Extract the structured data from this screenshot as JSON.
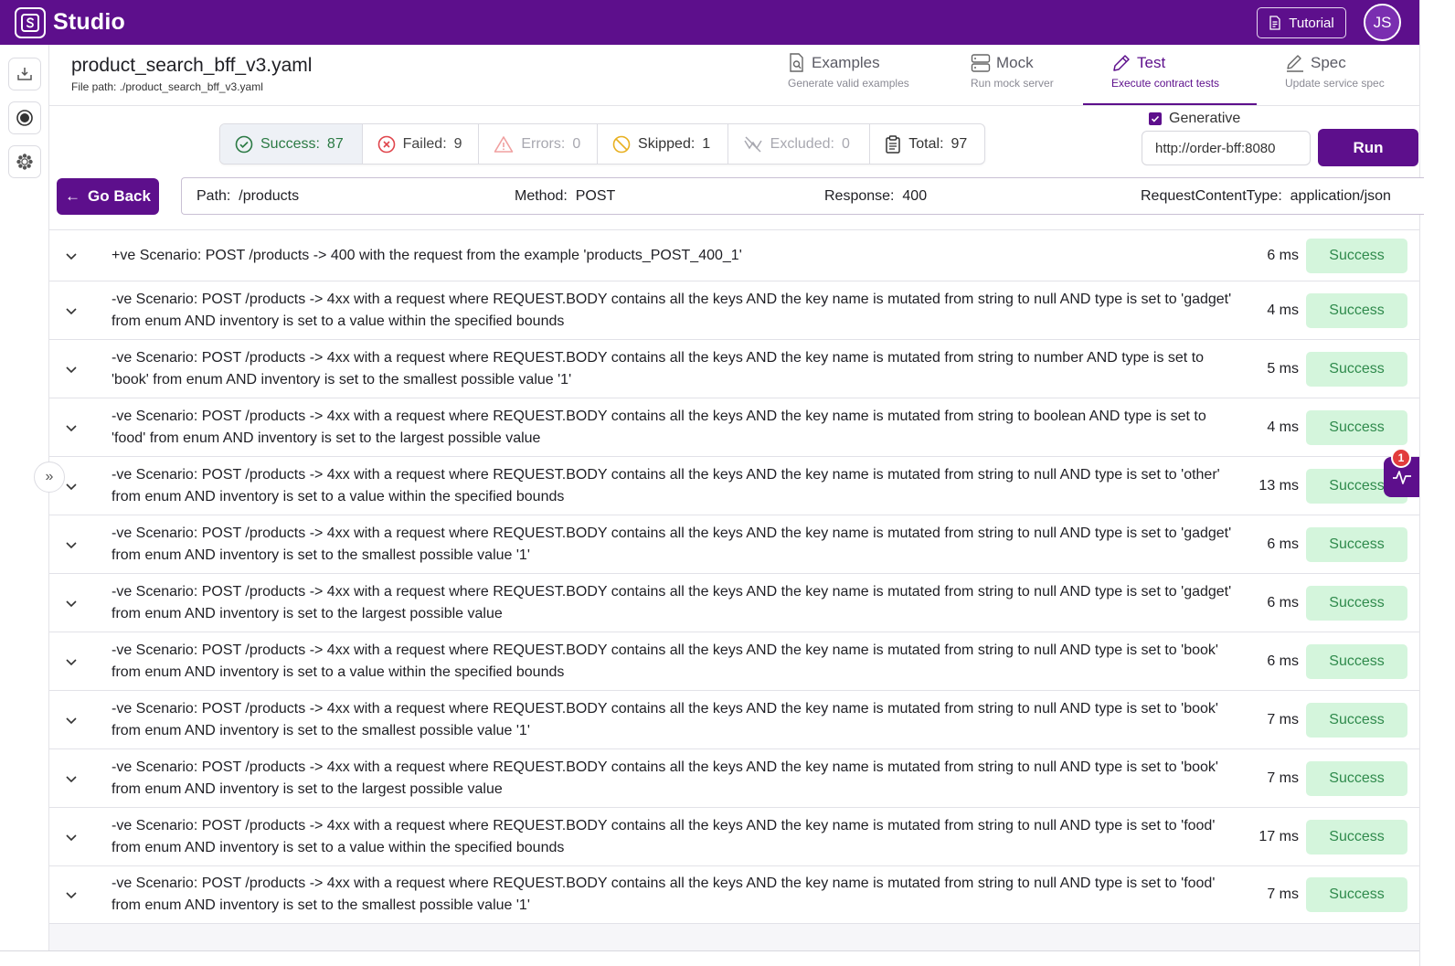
{
  "app": {
    "name": "Studio",
    "tutorial_label": "Tutorial",
    "avatar_initials": "JS"
  },
  "file": {
    "name": "product_search_bff_v3.yaml",
    "path": "File path: ./product_search_bff_v3.yaml"
  },
  "nav_tabs": [
    {
      "label": "Examples",
      "sub": "Generate valid examples",
      "icon": "file-search-icon",
      "active": false
    },
    {
      "label": "Mock",
      "sub": "Run mock server",
      "icon": "server-icon",
      "active": false
    },
    {
      "label": "Test",
      "sub": "Execute contract tests",
      "icon": "pencil-icon",
      "active": true
    },
    {
      "label": "Spec",
      "sub": "Update service spec",
      "icon": "edit-icon",
      "active": false
    }
  ],
  "summary": {
    "success": {
      "label": "Success:",
      "value": "87"
    },
    "failed": {
      "label": "Failed:",
      "value": "9"
    },
    "errors": {
      "label": "Errors:",
      "value": "0"
    },
    "skipped": {
      "label": "Skipped:",
      "value": "1"
    },
    "excluded": {
      "label": "Excluded:",
      "value": "0"
    },
    "total": {
      "label": "Total:",
      "value": "97"
    }
  },
  "controls": {
    "generative_label": "Generative",
    "generative_checked": true,
    "url_value": "http://order-bff:8080",
    "run_label": "Run",
    "go_back_label": "Go Back"
  },
  "info": {
    "path_label": "Path:",
    "path_value": "/products",
    "method_label": "Method:",
    "method_value": "POST",
    "response_label": "Response:",
    "response_value": "400",
    "content_type_label": "RequestContentType:",
    "content_type_value": "application/json"
  },
  "notification_count": "1",
  "colors": {
    "brand": "#5d0f8c",
    "success_bg": "#d4f5dc",
    "success_text": "#2f8a4c",
    "failed": "#e0454c",
    "skipped": "#e8b020"
  },
  "results": [
    {
      "text": "+ve Scenario: POST /products -> 400 with the request from the example 'products_POST_400_1'",
      "duration": "6 ms",
      "status": "Success"
    },
    {
      "text": "-ve Scenario: POST /products -> 4xx with a request where REQUEST.BODY contains all the keys AND the key name is mutated from string to null AND type is set to 'gadget' from enum AND inventory is set to a value within the specified bounds",
      "duration": "4 ms",
      "status": "Success"
    },
    {
      "text": "-ve Scenario: POST /products -> 4xx with a request where REQUEST.BODY contains all the keys AND the key name is mutated from string to number AND type is set to 'book' from enum AND inventory is set to the smallest possible value '1'",
      "duration": "5 ms",
      "status": "Success"
    },
    {
      "text": "-ve Scenario: POST /products -> 4xx with a request where REQUEST.BODY contains all the keys AND the key name is mutated from string to boolean AND type is set to 'food' from enum AND inventory is set to the largest possible value",
      "duration": "4 ms",
      "status": "Success"
    },
    {
      "text": "-ve Scenario: POST /products -> 4xx with a request where REQUEST.BODY contains all the keys AND the key name is mutated from string to null AND type is set to 'other' from enum AND inventory is set to a value within the specified bounds",
      "duration": "13 ms",
      "status": "Success"
    },
    {
      "text": "-ve Scenario: POST /products -> 4xx with a request where REQUEST.BODY contains all the keys AND the key name is mutated from string to null AND type is set to 'gadget' from enum AND inventory is set to the smallest possible value '1'",
      "duration": "6 ms",
      "status": "Success"
    },
    {
      "text": "-ve Scenario: POST /products -> 4xx with a request where REQUEST.BODY contains all the keys AND the key name is mutated from string to null AND type is set to 'gadget' from enum AND inventory is set to the largest possible value",
      "duration": "6 ms",
      "status": "Success"
    },
    {
      "text": "-ve Scenario: POST /products -> 4xx with a request where REQUEST.BODY contains all the keys AND the key name is mutated from string to null AND type is set to 'book' from enum AND inventory is set to a value within the specified bounds",
      "duration": "6 ms",
      "status": "Success"
    },
    {
      "text": "-ve Scenario: POST /products -> 4xx with a request where REQUEST.BODY contains all the keys AND the key name is mutated from string to null AND type is set to 'book' from enum AND inventory is set to the smallest possible value '1'",
      "duration": "7 ms",
      "status": "Success"
    },
    {
      "text": "-ve Scenario: POST /products -> 4xx with a request where REQUEST.BODY contains all the keys AND the key name is mutated from string to null AND type is set to 'book' from enum AND inventory is set to the largest possible value",
      "duration": "7 ms",
      "status": "Success"
    },
    {
      "text": "-ve Scenario: POST /products -> 4xx with a request where REQUEST.BODY contains all the keys AND the key name is mutated from string to null AND type is set to 'food' from enum AND inventory is set to a value within the specified bounds",
      "duration": "17 ms",
      "status": "Success"
    },
    {
      "text": "-ve Scenario: POST /products -> 4xx with a request where REQUEST.BODY contains all the keys AND the key name is mutated from string to null AND type is set to 'food' from enum AND inventory is set to the smallest possible value '1'",
      "duration": "7 ms",
      "status": "Success"
    }
  ]
}
